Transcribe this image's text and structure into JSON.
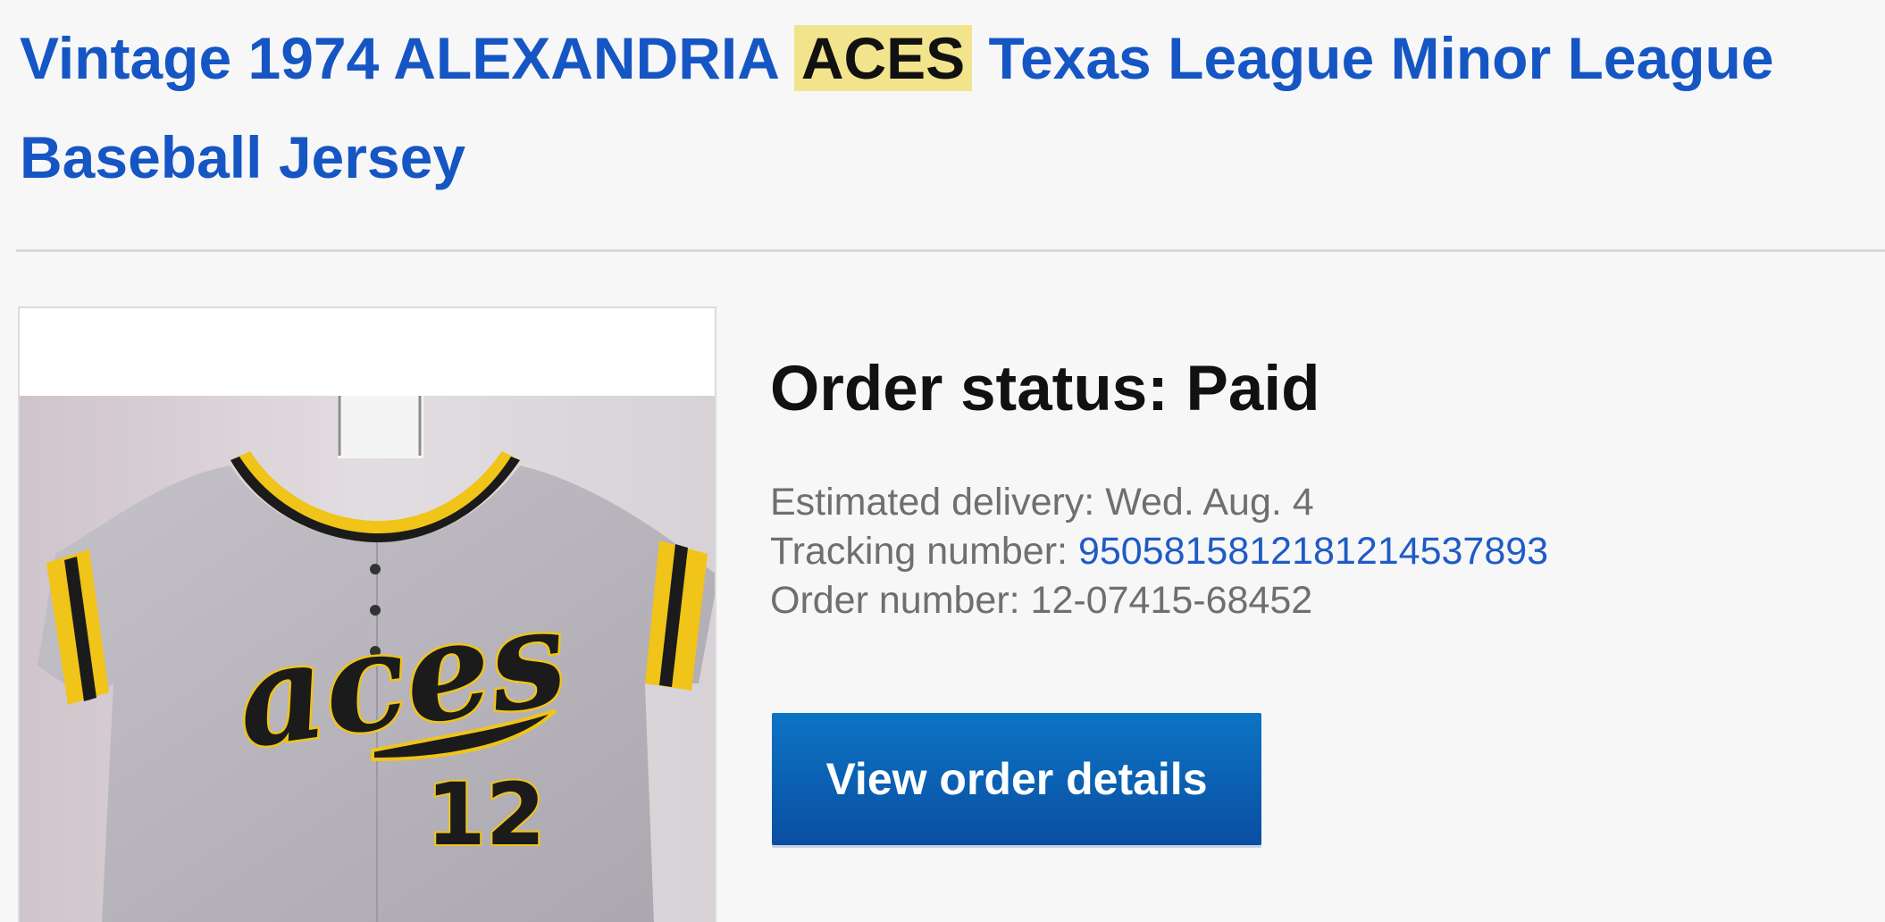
{
  "item": {
    "title_before": "Vintage 1974 ALEXANDRIA ",
    "title_highlight": "ACES",
    "title_after": " Texas League Minor League Baseball Jersey",
    "image_alt": "Vintage gray baseball jersey with aces script and number 12"
  },
  "jersey_graphic": {
    "script_text": "aces",
    "number_text": "12",
    "colors": {
      "jersey": "#b9b6bd",
      "trim_yellow": "#f0c419",
      "trim_black": "#1b1b1b",
      "wall": "#d4cdd2"
    }
  },
  "order": {
    "status_label": "Order status: Paid",
    "estimated_delivery": "Estimated delivery: Wed. Aug. 4",
    "tracking_label": "Tracking number: ",
    "tracking_number": "9505815812181214537893",
    "order_number": "Order number: 12-07415-68452",
    "view_button_label": "View order details"
  },
  "colors": {
    "link": "#1556c4",
    "highlight": "#f2e48c",
    "button": "#0a5fb3"
  }
}
